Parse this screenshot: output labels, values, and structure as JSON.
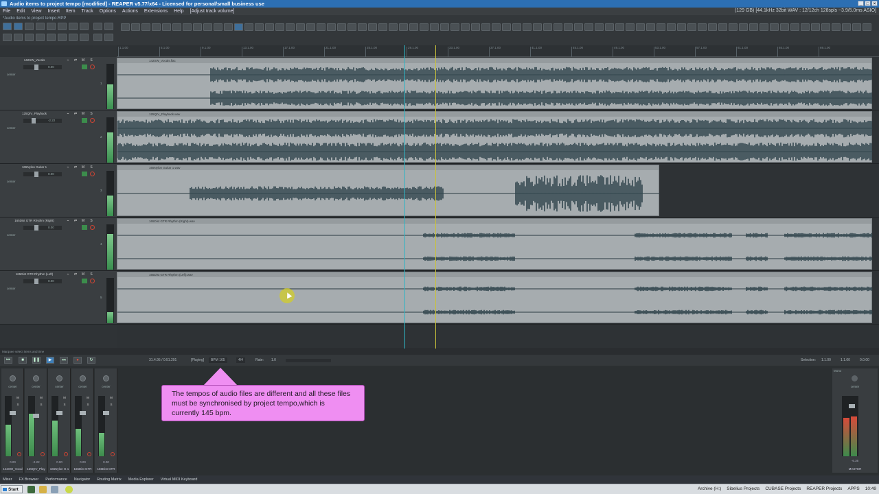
{
  "window": {
    "title": "Audio items to project tempo [modified] - REAPER v5.77/x64 - Licensed for personal/small business use",
    "project_path": "*Audio items to project tempo.RPP"
  },
  "menu": {
    "items": [
      "File",
      "Edit",
      "View",
      "Insert",
      "Item",
      "Track",
      "Options",
      "Actions",
      "Extensions",
      "Help",
      "[Adjust track volume]"
    ],
    "status_right": "(129 GB) [44.1kHz 32bit WAV : 12/12ch 128spls ~3.9/5.0ms ASIO]"
  },
  "ruler": {
    "labels": [
      "1.1.00",
      "5.1.00",
      "9.1.00",
      "13.1.00",
      "17.1.00",
      "21.1.00",
      "25.1.00",
      "29.1.00",
      "33.1.00",
      "37.1.00",
      "41.1.00",
      "45.1.00",
      "49.1.00",
      "53.1.00",
      "57.1.00",
      "61.1.00",
      "65.1.00",
      "69.1.00"
    ]
  },
  "tracks": [
    {
      "name": "142SW_Vocals",
      "volume": "0.00",
      "pan": "center",
      "number": "1",
      "item": "142SW_Vocals.flac"
    },
    {
      "name": "125QIV_Playback",
      "volume": "-2.22",
      "pan": "center",
      "number": "2",
      "item": "125QIV_Playback.wav"
    },
    {
      "name": "165Nylon Guitar 1",
      "volume": "0.00",
      "pan": "center",
      "number": "3",
      "item": "165Nylon Guitar 1.wav"
    },
    {
      "name": "165Dist GTR Rhythm (Right)",
      "volume": "0.00",
      "pan": "center",
      "number": "4",
      "item": "165Dist GTR Rhythm (Right).wav"
    },
    {
      "name": "165Dist GTR Rhythm (Left)",
      "volume": "0.00",
      "pan": "center",
      "number": "5",
      "item": "165Dist GTR Rhythm (Left).wav"
    }
  ],
  "status_line": "Marquee select items and time",
  "transport": {
    "position": "31.4.95 / 0:51.291",
    "state": "[Playing]",
    "bpm_label": "BPM",
    "bpm": "165",
    "time_signature": "4/4",
    "rate_label": "Rate:",
    "rate": "1.0",
    "selection_label": "Selection:",
    "selection_start": "1.1.00",
    "selection_end": "1.1.00",
    "selection_length": "0.0.00"
  },
  "mixer": {
    "channels": [
      {
        "name": "142SW_Vocal",
        "value": "0.00",
        "pan": "center",
        "number": "1"
      },
      {
        "name": "125QIV_Play",
        "value": "-2.22",
        "pan": "center",
        "number": "2"
      },
      {
        "name": "165Nylon G 1",
        "value": "0.00",
        "pan": "center",
        "number": "3"
      },
      {
        "name": "165Dist GTR",
        "value": "0.00",
        "pan": "center",
        "number": "4"
      },
      {
        "name": "165Dist GTR",
        "value": "0.00",
        "pan": "center",
        "number": "5"
      }
    ],
    "master": {
      "name": "MASTER",
      "value": "-6.36",
      "pan": "center",
      "mode": "Mono"
    }
  },
  "callout": {
    "text": "The tempos of audio files are different and all these files must be synchronised by project tempo,which is currently 145 bpm."
  },
  "dock_tabs": [
    "Mixer",
    "FX Browser",
    "Performance",
    "Navigator",
    "Routing Matrix",
    "Media Explorer",
    "Virtual MIDI Keyboard"
  ],
  "taskbar": {
    "start": "Start",
    "folders": [
      "Archive (H:)",
      "Sibelius Projects",
      "CUBASE Projects",
      "REAPER Projects",
      "APPS"
    ],
    "clock": "10:49"
  },
  "colors": {
    "title_bar": "#2c6fb3",
    "item_fill": "#a6acaf",
    "waveform": "#33474f",
    "edit_cursor": "#2fb5c4",
    "play_cursor": "#c9c13a",
    "callout": "#ef8ef2"
  }
}
